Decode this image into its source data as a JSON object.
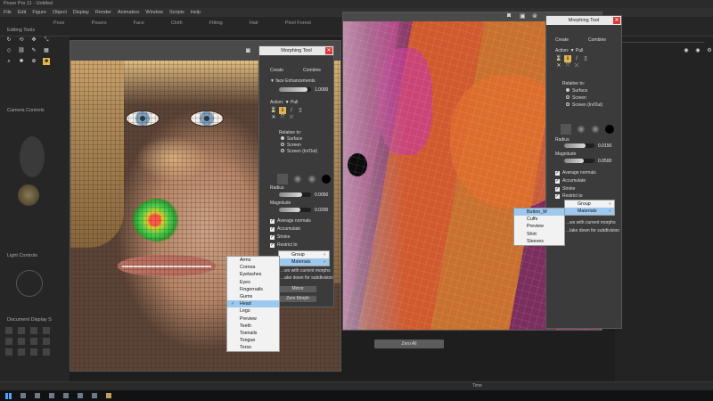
{
  "app": {
    "title": "Poser Pro 11 - Untitled"
  },
  "menu": [
    "File",
    "Edit",
    "Figure",
    "Object",
    "Display",
    "Render",
    "Animation",
    "Window",
    "Scripts",
    "Help"
  ],
  "tabs": [
    "Pose",
    "Posers",
    "Face",
    "Cloth",
    "Fitting",
    "Hair",
    "Pixel Forest"
  ],
  "left_panel": {
    "editing_tools": "Editing Tools",
    "camera_controls": "Camera Controls",
    "light_controls": "Light Controls",
    "document_display": "Document Display S"
  },
  "morph_left": {
    "title": "Morphing Tool",
    "tab_create": "Create",
    "tab_combine": "Combine",
    "group_label": "face Enhancements",
    "group_value": "1.0000",
    "action_label": "Action:",
    "action_value": "Pull",
    "relative_label": "Relative to:",
    "relative_options": [
      "Surface",
      "Screen",
      "Screen (In/Out)"
    ],
    "radius_label": "Radius",
    "radius_value": "0.0050",
    "magnitude_label": "Magnitude",
    "magnitude_value": "0.0200",
    "checks": [
      "Average normals",
      "Accumulate",
      "Stroke",
      "Restrict to"
    ],
    "note_1": "...ws with current morphs",
    "note_2": "...ake down for subdivision",
    "btn_mirror": "Mirror",
    "btn_zero": "Zero Morph"
  },
  "morph_right": {
    "title": "Morphing Tool",
    "tab_create": "Create",
    "tab_combine": "Combine",
    "action_label": "Action:",
    "action_value": "Pull",
    "relative_label": "Relative to:",
    "relative_options": [
      "Surface",
      "Screen",
      "Screen (In/Out)"
    ],
    "radius_label": "Radius",
    "radius_value": "0.0150",
    "magnitude_label": "Magnitude",
    "magnitude_value": "0.0500",
    "checks": [
      "Average normals",
      "Accumulate",
      "Stroke",
      "Restrict to"
    ],
    "note_1": "...ws with current morphs",
    "note_2": "...lake down for subdivision"
  },
  "menu_left_sub": {
    "items": [
      {
        "label": "Group",
        "has_arrow": true,
        "selected": false
      },
      {
        "label": "Materials",
        "has_arrow": true,
        "selected": true
      }
    ]
  },
  "menu_left_list": {
    "items": [
      {
        "label": "Arms",
        "checked": false
      },
      {
        "label": "Cornea",
        "checked": false
      },
      {
        "label": "Eyelashes",
        "checked": false
      },
      {
        "label": "Eyes",
        "checked": false
      },
      {
        "label": "Fingernails",
        "checked": false
      },
      {
        "label": "Gums",
        "checked": false
      },
      {
        "label": "Head",
        "checked": true
      },
      {
        "label": "Legs",
        "checked": false
      },
      {
        "label": "Preview",
        "checked": false
      },
      {
        "label": "Teeth",
        "checked": false
      },
      {
        "label": "Toenails",
        "checked": false
      },
      {
        "label": "Tongue",
        "checked": false
      },
      {
        "label": "Torso",
        "checked": false
      }
    ]
  },
  "menu_right_sub": {
    "items": [
      {
        "label": "Group",
        "has_arrow": true,
        "selected": false
      },
      {
        "label": "Materials",
        "has_arrow": true,
        "selected": true
      }
    ]
  },
  "menu_right_list": {
    "items": [
      {
        "label": "Button_M",
        "selected": true
      },
      {
        "label": "Cuffs",
        "selected": false
      },
      {
        "label": "Preview",
        "selected": false
      },
      {
        "label": "Shirt",
        "selected": false
      },
      {
        "label": "Sleeves",
        "selected": false
      }
    ]
  },
  "bottom": {
    "zero_all": "Zero All",
    "time": "Time"
  },
  "colors": {
    "accent": "#e3b54a",
    "highlight": "#9ec9ef",
    "close": "#d83b3b"
  }
}
